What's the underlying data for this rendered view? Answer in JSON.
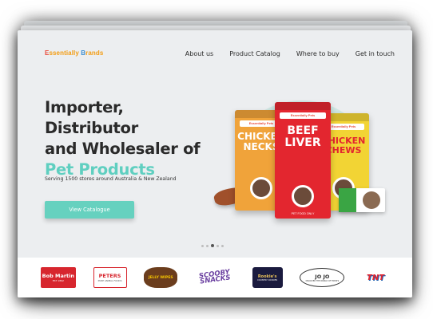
{
  "logo": {
    "parts": [
      "E",
      "ssentially ",
      "B",
      "rands",
      ""
    ]
  },
  "nav": {
    "items": [
      "About us",
      "Product Catalog",
      "Where to buy",
      "Get in touch"
    ]
  },
  "hero": {
    "line1": "Importer, Distributor",
    "line2": "and Wholesaler of",
    "line3": "Pet Products",
    "subtitle": "Serving 1500 stores around Australia & New Zealand",
    "cta_label": "View Catalogue"
  },
  "products": {
    "bag1_name": "CHICKEN NECKS",
    "bag2_name": "BEEF LIVER",
    "bag3_name": "CHICKEN CHEWS",
    "bag_brand": "Essentially Pets",
    "bag2_foot": "PET FOOD ONLY"
  },
  "carousel": {
    "count": 5,
    "active_index": 2
  },
  "brands": {
    "bob_martin": "Bob Martin",
    "bob_martin_sub": "EST 1892",
    "peters": "PETERS",
    "peters_sub": "PURE ANIMAL FOODS",
    "jelly_wipes": "JELLY WIPES",
    "scooby_1": "SCOOBY",
    "scooby_2": "SNACKS",
    "rookies": "Rookie's",
    "rookies_sub": "COUNTRY COOKIES",
    "jojo": "JO JO",
    "jojo_sub": "DISCOVER THE WORLD OF TREATS",
    "tnt": "TNT"
  },
  "colors": {
    "accent": "#66d1bf",
    "red": "#e3262f",
    "orange": "#f0a33a",
    "yellow": "#f2d434"
  }
}
